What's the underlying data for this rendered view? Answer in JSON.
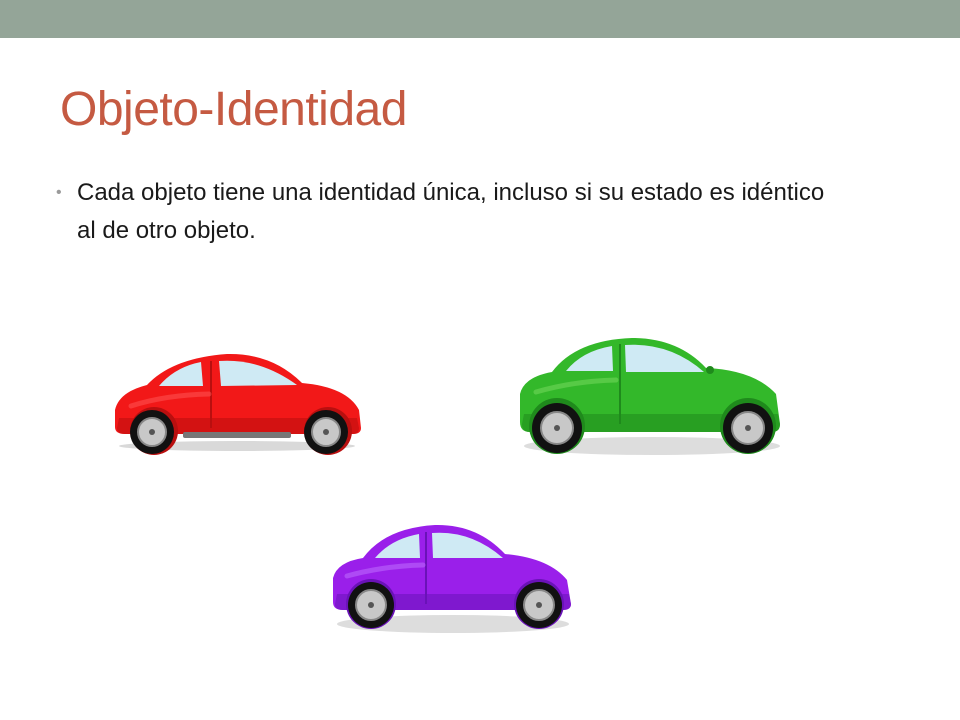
{
  "slide": {
    "title": "Objeto-Identidad",
    "bullets": [
      {
        "marker": "•",
        "text": "Cada objeto tiene una identidad única, incluso si su estado es idéntico al de otro objeto."
      }
    ]
  },
  "colors": {
    "top_band": "#94a598",
    "title": "#c55a42",
    "car_red": {
      "body": "#f21818",
      "dark": "#b90f0f",
      "light": "#ff5a5a"
    },
    "car_green": {
      "body": "#33b82a",
      "dark": "#1f8a1c",
      "light": "#7bdc62"
    },
    "car_purple": {
      "body": "#9a1fea",
      "dark": "#6a12b8",
      "light": "#c276ff"
    },
    "window": "#cfeaf4",
    "tire": "#111111",
    "hubcap": "#c8c8c8"
  },
  "illustrations": [
    {
      "name": "red-car",
      "color_key": "car_red"
    },
    {
      "name": "green-car",
      "color_key": "car_green"
    },
    {
      "name": "purple-car",
      "color_key": "car_purple"
    }
  ]
}
